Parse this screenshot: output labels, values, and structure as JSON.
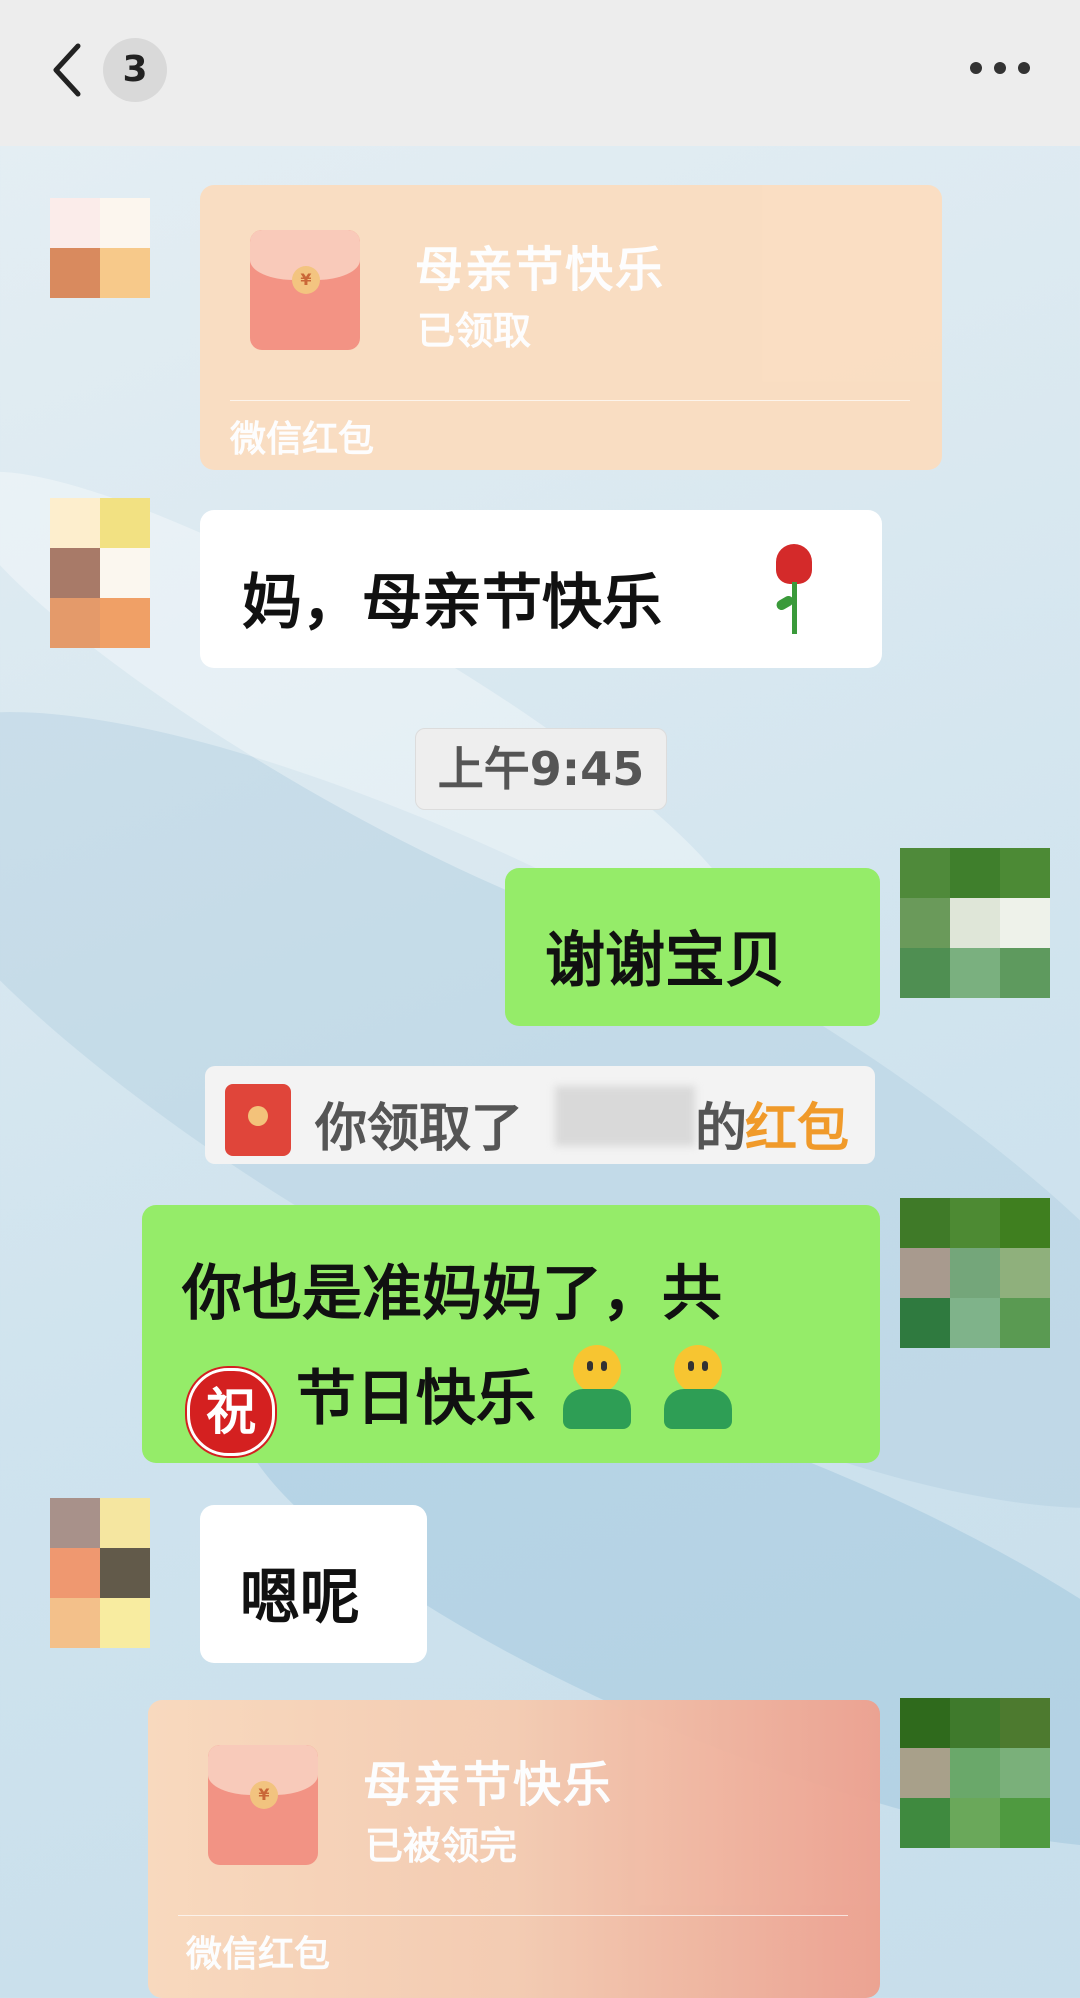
{
  "header": {
    "back_icon": "chevron-left-icon",
    "unread_count": "3",
    "more_icon": "more-horizontal-icon"
  },
  "messages": {
    "packet1": {
      "title": "母亲节快乐",
      "status": "已领取",
      "footer": "微信红包"
    },
    "text1": {
      "text": "妈，母亲节快乐",
      "emoji": "rose"
    },
    "time": "上午9:45",
    "text2": {
      "text": "谢谢宝贝"
    },
    "system": {
      "prefix": "你领取了",
      "suffix": "的",
      "highlight": "红包",
      "highlight_color": "#f09a2a"
    },
    "text3": {
      "line1": "你也是准妈妈了，共",
      "zhu": "祝",
      "line2": "节日快乐",
      "emoji": "person-smiley"
    },
    "text4": {
      "text": "嗯呢"
    },
    "packet2": {
      "title": "母亲节快乐",
      "status": "已被领完",
      "footer": "微信红包"
    }
  },
  "colors": {
    "header_bg": "#ededed",
    "green_bubble": "#95ec69",
    "white_bubble": "#ffffff",
    "packet_bg": "#fbddc0"
  }
}
